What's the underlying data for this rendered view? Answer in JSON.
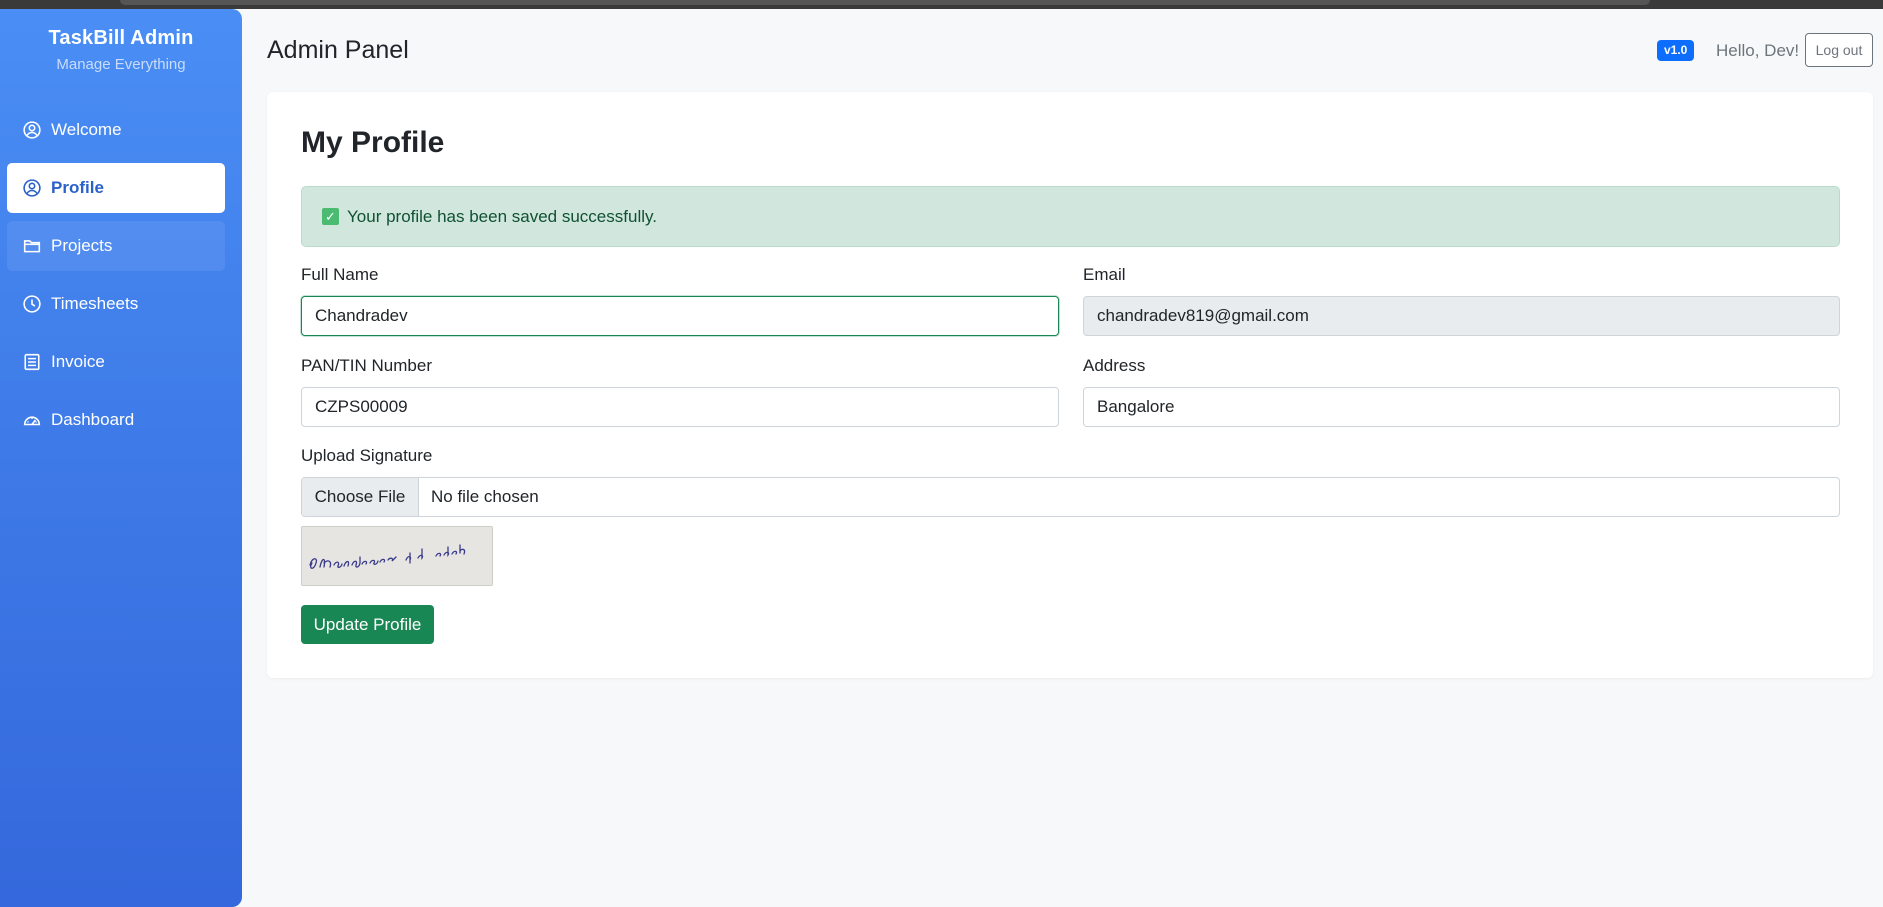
{
  "brand": {
    "title": "TaskBill Admin",
    "subtitle": "Manage Everything"
  },
  "sidebar": {
    "items": [
      {
        "label": "Welcome",
        "icon": "user-circle-icon"
      },
      {
        "label": "Profile",
        "icon": "user-circle-icon",
        "active": true
      },
      {
        "label": "Projects",
        "icon": "folder-icon"
      },
      {
        "label": "Timesheets",
        "icon": "clock-icon"
      },
      {
        "label": "Invoice",
        "icon": "invoice-icon"
      },
      {
        "label": "Dashboard",
        "icon": "speedometer-icon"
      }
    ]
  },
  "header": {
    "title": "Admin Panel",
    "version": "v1.0",
    "greeting": "Hello, Dev!",
    "logout_label": "Log out"
  },
  "profile": {
    "title": "My Profile",
    "alert": "Your profile has been saved successfully.",
    "fields": {
      "full_name": {
        "label": "Full Name",
        "value": "Chandradev"
      },
      "email": {
        "label": "Email",
        "value": "chandradev819@gmail.com"
      },
      "pan": {
        "label": "PAN/TIN Number",
        "value": "CZPS00009"
      },
      "address": {
        "label": "Address",
        "value": "Bangalore"
      }
    },
    "signature": {
      "label": "Upload Signature",
      "choose_label": "Choose File",
      "file_status": "No file chosen",
      "image_text": "Chandradev pd sah"
    },
    "submit_label": "Update Profile"
  },
  "colors": {
    "sidebar_top": "#4a8ef5",
    "sidebar_bottom": "#3468dc",
    "success": "#198754",
    "alert_bg": "#d1e7dd",
    "badge": "#0d6efd"
  }
}
